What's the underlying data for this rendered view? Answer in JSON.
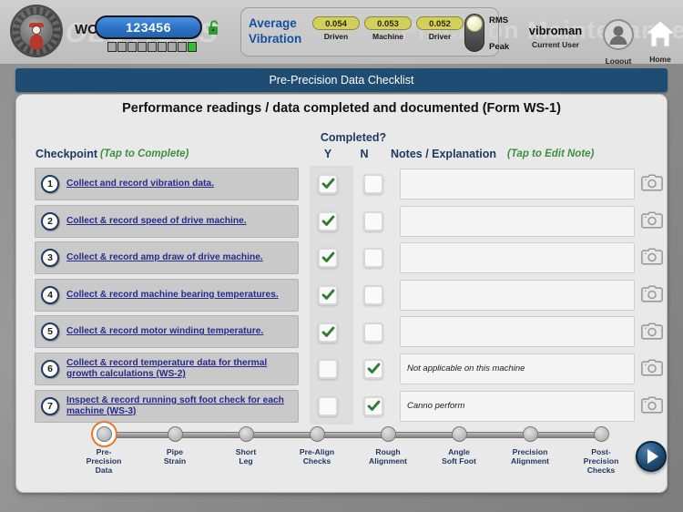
{
  "header": {
    "watermark_left": "SOLUTIONS",
    "watermark_right": "Precision Maintenance",
    "wo_label": "WO:",
    "wo_value": "123456",
    "lock_icon": "unlock-icon",
    "progress_segments": 9,
    "progress_filled_index": 8,
    "vibration": {
      "title_line1": "Average",
      "title_line2": "Vibration",
      "chips": [
        {
          "value": "0.054",
          "caption": "Driven"
        },
        {
          "value": "0.053",
          "caption": "Machine"
        },
        {
          "value": "0.052",
          "caption": "Driver"
        }
      ],
      "toggle_top_label": "RMS",
      "toggle_bottom_label": "Peak",
      "toggle_position": "RMS",
      "chip_color": "#d2d05a",
      "title_color": "#1450a0"
    },
    "user_name": "vibroman",
    "user_caption": "Current User",
    "logout_label": "Logout",
    "logout_icon": "user-avatar-icon",
    "home_label": "Home",
    "home_icon": "home-icon",
    "logo_icon": "company-seal-logo-icon"
  },
  "title_bar": {
    "title": "Pre-Precision Data Checklist",
    "bg_color": "#1e4c72"
  },
  "main": {
    "subtitle": "Performance readings / data completed and documented (Form WS-1)",
    "columns": {
      "checkpoint": "Checkpoint",
      "checkpoint_hint": "(Tap to Complete)",
      "completed": "Completed?",
      "yes": "Y",
      "no": "N",
      "notes": "Notes / Explanation",
      "notes_hint": "(Tap to Edit Note)"
    },
    "hint_color": "#3f8f3f",
    "header_color": "#1f3a63",
    "check_color": "#2f7d32",
    "rows": [
      {
        "num": "1",
        "task": "Collect and record vibration data.",
        "yes": true,
        "no": false,
        "note": ""
      },
      {
        "num": "2",
        "task": "Collect & record speed of drive machine.",
        "yes": true,
        "no": false,
        "note": ""
      },
      {
        "num": "3",
        "task": "Collect & record amp draw of drive machine.",
        "yes": true,
        "no": false,
        "note": ""
      },
      {
        "num": "4",
        "task": "Collect & record machine bearing temperatures.",
        "yes": true,
        "no": false,
        "note": ""
      },
      {
        "num": "5",
        "task": "Collect & record motor winding temperature.",
        "yes": true,
        "no": false,
        "note": ""
      },
      {
        "num": "6",
        "task": "Collect & record temperature data for thermal growth calculations (WS-2)",
        "yes": false,
        "no": true,
        "note": "Not applicable on this machine"
      },
      {
        "num": "7",
        "task": "Inspect & record running soft foot check for each machine (WS-3)",
        "yes": false,
        "no": true,
        "note": "Canno perform"
      }
    ],
    "camera_icon": "camera-icon"
  },
  "stepper": {
    "active_index": 0,
    "active_color": "#e8782a",
    "steps": [
      {
        "label": "Pre-\nPrecision\nData"
      },
      {
        "label": "Pipe\nStrain"
      },
      {
        "label": "Short\nLeg"
      },
      {
        "label": "Pre-Align\nChecks"
      },
      {
        "label": "Rough\nAlignment"
      },
      {
        "label": "Angle\nSoft Foot"
      },
      {
        "label": "Precision\nAlignment"
      },
      {
        "label": "Post-\nPrecision\nChecks"
      }
    ],
    "next_button_icon": "play-arrow-icon"
  }
}
